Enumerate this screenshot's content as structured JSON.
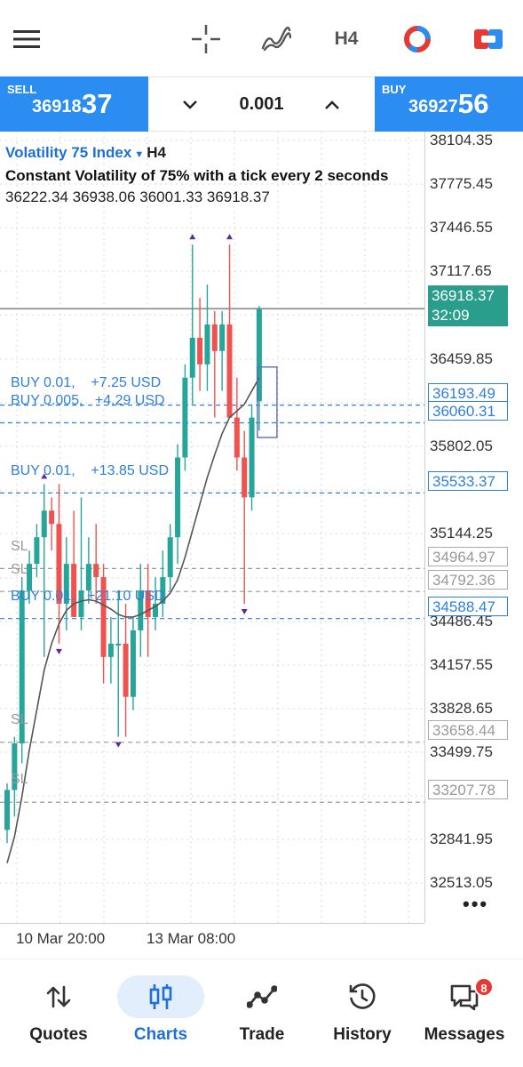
{
  "toolbar": {
    "menu_icon": "hamburger-menu-icon",
    "crosshair_icon": "crosshair-icon",
    "indicators_icon": "indicators-icon",
    "timeframe": "H4",
    "objects_icon": "ring-icon",
    "trade_icon": "one-click-trading-icon"
  },
  "trade": {
    "sell_label": "SELL",
    "sell_price_small": "36918.",
    "sell_price_big": "37",
    "volume": "0.001",
    "buy_label": "BUY",
    "buy_price_small": "36927.",
    "buy_price_big": "56"
  },
  "chart": {
    "symbol": "Volatility 75 Index",
    "timeframe": "H4",
    "description": "Constant Volatility of 75% with a tick every 2 seconds",
    "ohlc": "36222.34 36938.06 36001.33 36918.37",
    "y_axis": [
      "38104.35",
      "37775.45",
      "37446.55",
      "37117.65",
      "36459.85",
      "35802.05",
      "35144.25",
      "34486.45",
      "34157.55",
      "33828.65",
      "33499.75",
      "32841.95",
      "32513.05"
    ],
    "current_price": "36918.37",
    "countdown": "32:09",
    "orders": [
      {
        "label": "BUY 0.01,    +7.25 USD",
        "price": "36193.49"
      },
      {
        "label": "BUY 0.005,   +4.29 USD",
        "price": "36060.31"
      },
      {
        "label": "BUY 0.01,    +13.85 USD",
        "price": "35533.37"
      },
      {
        "label": "BUY 0.01,   +21.10 USD",
        "price": "34588.47"
      }
    ],
    "stop_losses": [
      {
        "label": "SL",
        "price": "34964.97"
      },
      {
        "label": "SL",
        "price": "34792.36"
      },
      {
        "label": "SL",
        "price": "33658.44"
      },
      {
        "label": "SL",
        "price": "33207.78"
      }
    ],
    "x_axis": [
      "10 Mar 20:00",
      "13 Mar 08:00"
    ],
    "more": "•••"
  },
  "nav": {
    "items": [
      {
        "label": "Quotes",
        "icon": "quotes-arrows-icon"
      },
      {
        "label": "Charts",
        "icon": "charts-candles-icon"
      },
      {
        "label": "Trade",
        "icon": "trade-line-icon"
      },
      {
        "label": "History",
        "icon": "history-clock-icon"
      },
      {
        "label": "Messages",
        "icon": "messages-icon",
        "badge": "8"
      }
    ],
    "active": "Charts"
  },
  "colors": {
    "accent": "#2b8cf2",
    "bull": "#26a69a",
    "bear": "#ef5350",
    "order_line": "#2f7fe0",
    "sl_line": "#999999",
    "current_price_tag": "#2a9e8d"
  },
  "chart_data": {
    "type": "candlestick",
    "y_range": [
      32300,
      38250
    ],
    "candles": [
      {
        "o": 33000,
        "h": 33350,
        "l": 32900,
        "c": 33300
      },
      {
        "o": 33300,
        "h": 33700,
        "l": 33100,
        "c": 33650
      },
      {
        "o": 33650,
        "h": 34900,
        "l": 33500,
        "c": 34800
      },
      {
        "o": 34800,
        "h": 35100,
        "l": 34700,
        "c": 35000
      },
      {
        "o": 35000,
        "h": 35300,
        "l": 34900,
        "c": 35200
      },
      {
        "o": 35200,
        "h": 35600,
        "l": 34300,
        "c": 35400
      },
      {
        "o": 35400,
        "h": 35500,
        "l": 35100,
        "c": 35300
      },
      {
        "o": 35300,
        "h": 35600,
        "l": 34400,
        "c": 34700
      },
      {
        "o": 34700,
        "h": 35200,
        "l": 34500,
        "c": 35000
      },
      {
        "o": 35000,
        "h": 35400,
        "l": 34600,
        "c": 34600
      },
      {
        "o": 34600,
        "h": 35500,
        "l": 34500,
        "c": 34800
      },
      {
        "o": 34800,
        "h": 35200,
        "l": 34700,
        "c": 35000
      },
      {
        "o": 35000,
        "h": 35300,
        "l": 34700,
        "c": 34900
      },
      {
        "o": 34900,
        "h": 35000,
        "l": 34100,
        "c": 34300
      },
      {
        "o": 34300,
        "h": 34600,
        "l": 34100,
        "c": 34400
      },
      {
        "o": 34400,
        "h": 34800,
        "l": 33700,
        "c": 34400
      },
      {
        "o": 34400,
        "h": 34700,
        "l": 33700,
        "c": 34000
      },
      {
        "o": 34000,
        "h": 34600,
        "l": 33900,
        "c": 34500
      },
      {
        "o": 34500,
        "h": 35000,
        "l": 34300,
        "c": 34800
      },
      {
        "o": 34800,
        "h": 35000,
        "l": 34300,
        "c": 34600
      },
      {
        "o": 34600,
        "h": 34900,
        "l": 34500,
        "c": 34700
      },
      {
        "o": 34700,
        "h": 35100,
        "l": 34600,
        "c": 34900
      },
      {
        "o": 34900,
        "h": 35300,
        "l": 34800,
        "c": 35200
      },
      {
        "o": 35200,
        "h": 35900,
        "l": 35000,
        "c": 35800
      },
      {
        "o": 35800,
        "h": 36500,
        "l": 35700,
        "c": 36400
      },
      {
        "o": 36400,
        "h": 37400,
        "l": 36200,
        "c": 36700
      },
      {
        "o": 36700,
        "h": 37000,
        "l": 36300,
        "c": 36500
      },
      {
        "o": 36500,
        "h": 37100,
        "l": 36300,
        "c": 36800
      },
      {
        "o": 36800,
        "h": 36900,
        "l": 36100,
        "c": 36600
      },
      {
        "o": 36600,
        "h": 36900,
        "l": 36300,
        "c": 36800
      },
      {
        "o": 36800,
        "h": 37400,
        "l": 36100,
        "c": 36100
      },
      {
        "o": 36100,
        "h": 36400,
        "l": 35700,
        "c": 35800
      },
      {
        "o": 35800,
        "h": 36000,
        "l": 34700,
        "c": 35500
      },
      {
        "o": 35500,
        "h": 36200,
        "l": 35400,
        "c": 36100
      },
      {
        "o": 36222.34,
        "h": 36938.06,
        "l": 36001.33,
        "c": 36918.37
      }
    ],
    "moving_average": [
      32750,
      32950,
      33250,
      33600,
      33900,
      34200,
      34400,
      34550,
      34650,
      34700,
      34720,
      34730,
      34720,
      34690,
      34660,
      34620,
      34600,
      34600,
      34620,
      34650,
      34680,
      34720,
      34780,
      34880,
      35050,
      35250,
      35450,
      35650,
      35820,
      35980,
      36100,
      36150,
      36200,
      36300,
      36400
    ],
    "fractal_up": [
      5,
      25,
      30
    ],
    "fractal_down": [
      7,
      15,
      32
    ],
    "current_price": 36918.37,
    "order_prices": [
      36193.49,
      36060.31,
      35533.37,
      34588.47
    ],
    "sl_prices": [
      34964.97,
      34792.36,
      33658.44,
      33207.78
    ],
    "grid": true
  }
}
